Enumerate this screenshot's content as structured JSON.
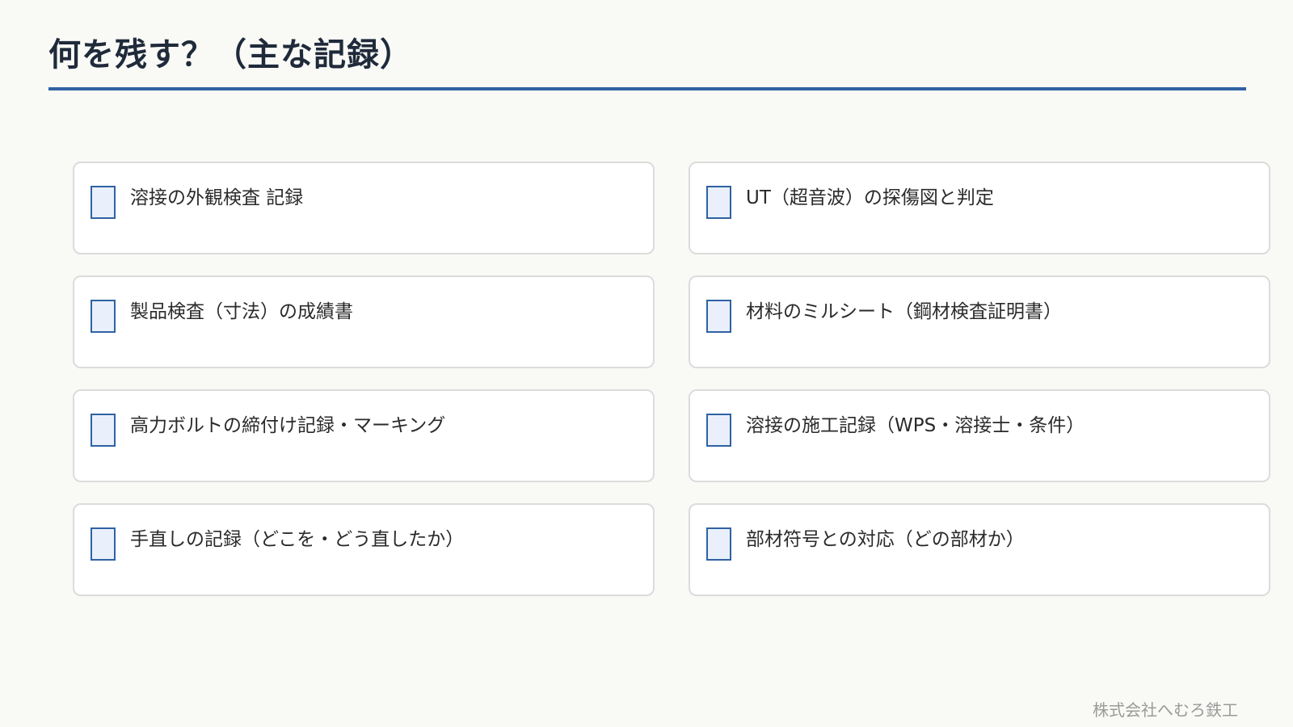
{
  "slide": {
    "title": "何を残す？（主な記録）",
    "footer": "株式会社へむろ鉄工"
  },
  "records": [
    {
      "label": "溶接の外観検査 記録",
      "checked": false
    },
    {
      "label": "UT（超音波）の探傷図と判定",
      "checked": false
    },
    {
      "label": "製品検査（寸法）の成績書",
      "checked": false
    },
    {
      "label": "材料のミルシート（鋼材検査証明書）",
      "checked": false
    },
    {
      "label": "高力ボルトの締付け記録・マーキング",
      "checked": false
    },
    {
      "label": "溶接の施工記録（WPS・溶接士・条件）",
      "checked": false
    },
    {
      "label": "手直しの記録（どこを・どう直したか）",
      "checked": false
    },
    {
      "label": "部材符号との対応（どの部材か）",
      "checked": false
    }
  ],
  "colors": {
    "accent": "#2f62a3",
    "checkbox_fill": "#e9f0fb",
    "background": "#f9f9f6"
  }
}
